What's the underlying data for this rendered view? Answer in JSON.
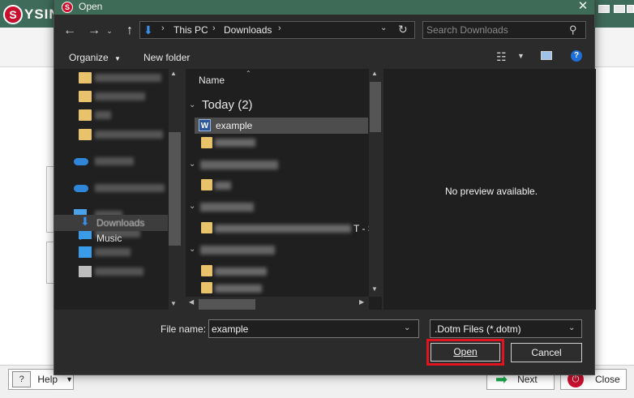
{
  "background_app": {
    "logo_text": "YSIN",
    "logo_letter": "S",
    "help_label": "Help",
    "next_label": "Next",
    "close_label": "Close"
  },
  "dialog": {
    "title": "Open",
    "close_glyph": "✕",
    "address": {
      "crumbs": [
        "This PC",
        "Downloads"
      ]
    },
    "search": {
      "placeholder": "Search Downloads"
    },
    "toolbar": {
      "organize_label": "Organize",
      "new_folder_label": "New folder"
    },
    "nav_pane": {
      "visible_items": [
        "Downloads",
        "Music"
      ]
    },
    "file_list": {
      "column_name": "Name",
      "group_today": "Today (2)",
      "selected_file": "example",
      "fragment_text": "T - S"
    },
    "preview_text": "No preview available.",
    "file_name_label": "File name:",
    "file_name_value": "example",
    "file_type_value": ".Dotm Files (*.dotm)",
    "open_label": "Open",
    "cancel_label": "Cancel"
  }
}
